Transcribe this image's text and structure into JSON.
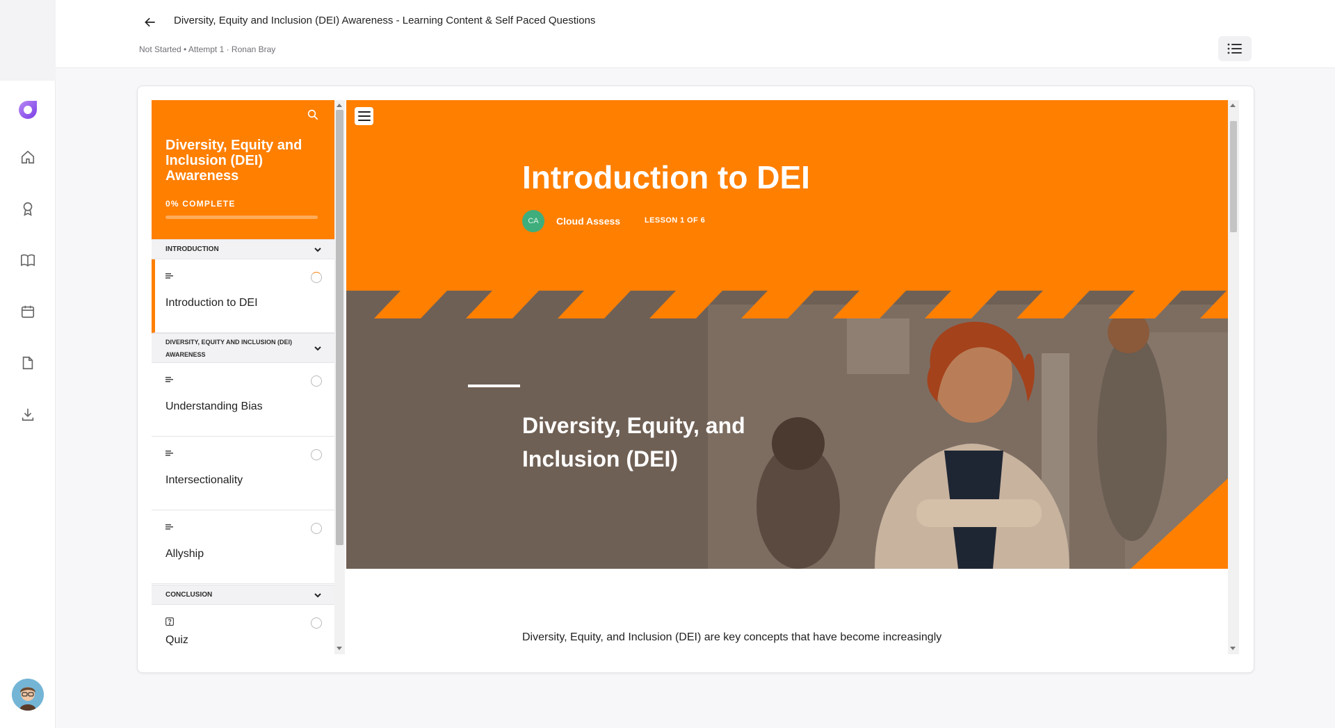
{
  "header": {
    "title": "Diversity, Equity and Inclusion (DEI) Awareness - Learning Content & Self Paced Questions",
    "meta": "Not Started • Attempt 1 · Ronan Bray"
  },
  "app_nav": {
    "items": [
      "home-icon",
      "award-icon",
      "book-icon",
      "calendar-icon",
      "document-icon",
      "download-icon"
    ]
  },
  "sidebar": {
    "course_title": "Diversity, Equity and Inclusion (DEI) Awareness",
    "progress_label": "0% COMPLETE",
    "progress": 0,
    "sections": [
      {
        "label": "INTRODUCTION",
        "lessons": [
          {
            "title": "Introduction to DEI",
            "type": "text-icon",
            "active": true
          }
        ]
      },
      {
        "label": "DIVERSITY, EQUITY AND INCLUSION (DEI) AWARENESS",
        "lessons": [
          {
            "title": "Understanding Bias",
            "type": "text-icon"
          },
          {
            "title": "Intersectionality",
            "type": "text-icon"
          },
          {
            "title": "Allyship",
            "type": "text-icon"
          }
        ]
      },
      {
        "label": "CONCLUSION",
        "lessons": [
          {
            "title": "Quiz",
            "type": "quiz-icon"
          }
        ]
      }
    ]
  },
  "lesson": {
    "title": "Introduction to DEI",
    "author_initials": "CA",
    "author": "Cloud Assess",
    "count": "LESSON 1 OF 6",
    "banner_heading": "Diversity, Equity, and Inclusion (DEI)",
    "body": "Diversity, Equity, and Inclusion (DEI) are key concepts that have become increasingly"
  },
  "colors": {
    "accent": "#ff7f00",
    "banner": "#6f6055",
    "author_avatar": "#3fae7c"
  }
}
